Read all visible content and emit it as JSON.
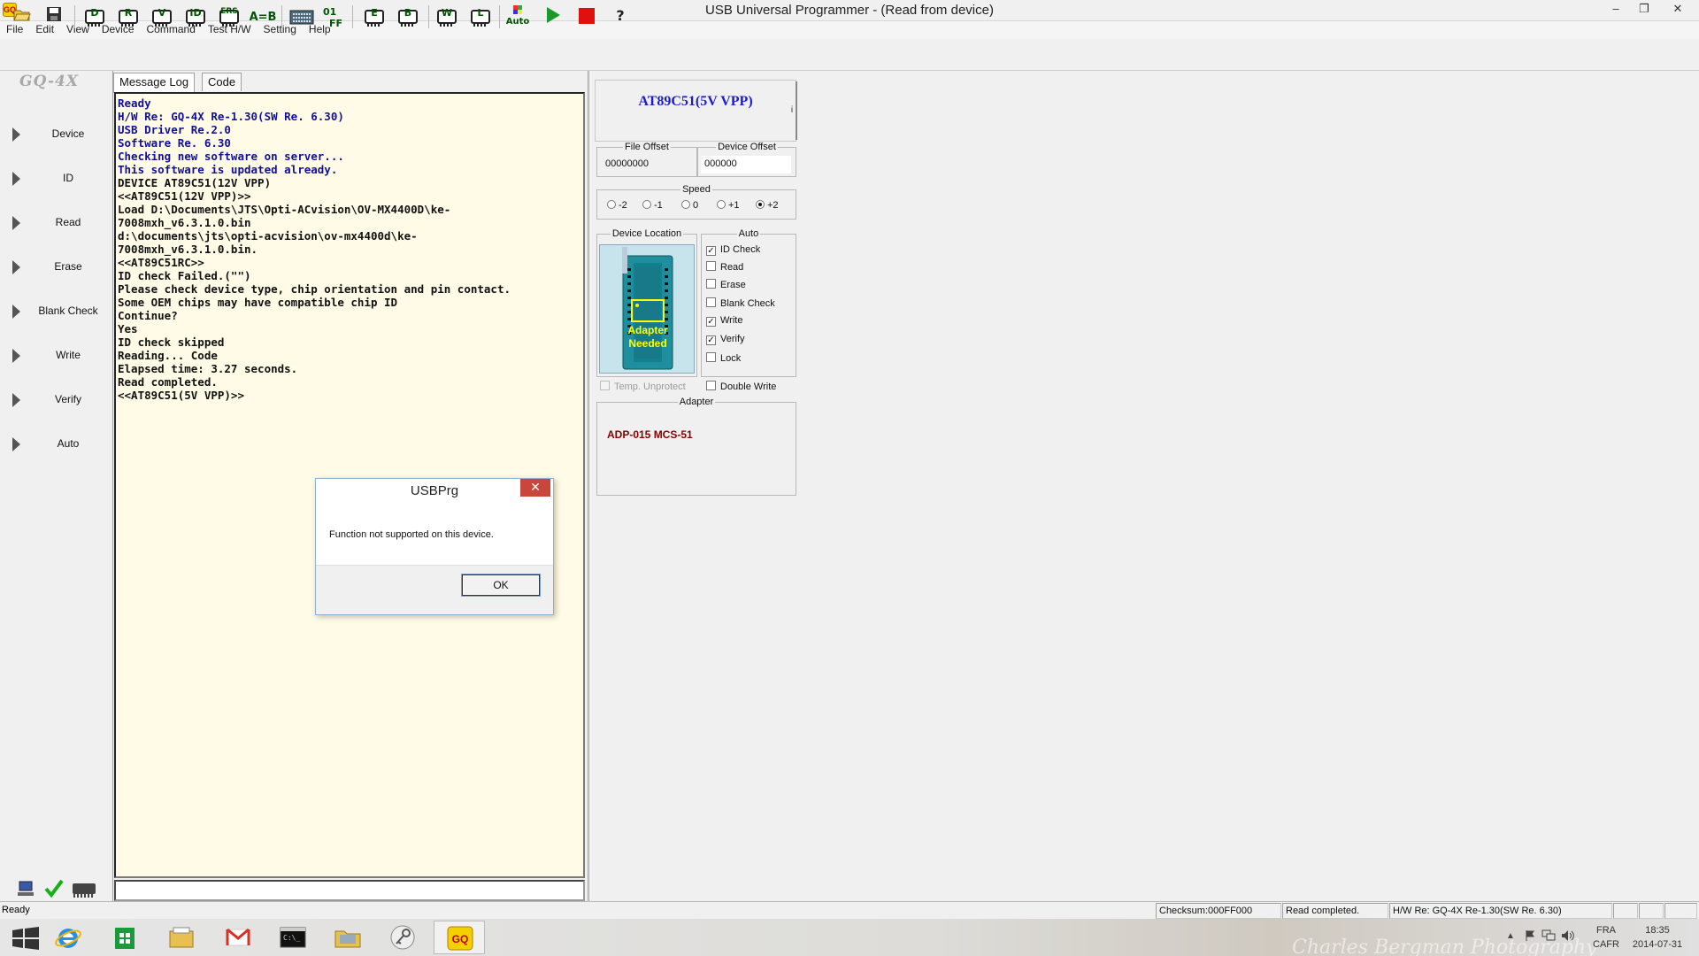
{
  "window": {
    "title": "USB Universal Programmer - (Read from device)",
    "app_icon_text": "GQ",
    "minimize_glyph": "–",
    "restore_glyph": "❐",
    "close_glyph": "✕"
  },
  "menu": [
    "File",
    "Edit",
    "View",
    "Device",
    "Command",
    "Test H/W",
    "Setting",
    "Help"
  ],
  "toolbar": {
    "buttons": [
      {
        "name": "open-icon",
        "label": ""
      },
      {
        "name": "save-icon",
        "label": ""
      },
      {
        "name": "device-icon",
        "label": "D"
      },
      {
        "name": "read-icon",
        "label": "R"
      },
      {
        "name": "verify-icon",
        "label": "V"
      },
      {
        "name": "id-icon",
        "label": "ID"
      },
      {
        "name": "erase-icon",
        "label": "ERS"
      },
      {
        "name": "compare-icon",
        "label": "A=B"
      },
      {
        "name": "keyboard-icon",
        "label": ""
      },
      {
        "name": "blank-check-icon",
        "label": "01FF"
      },
      {
        "name": "edit-icon",
        "label": "E"
      },
      {
        "name": "buffer-icon",
        "label": "B"
      },
      {
        "name": "write-icon",
        "label": "W"
      },
      {
        "name": "lock-icon",
        "label": "L"
      },
      {
        "name": "auto-icon",
        "label": "Auto"
      },
      {
        "name": "play-icon",
        "label": ""
      },
      {
        "name": "stop-icon",
        "label": ""
      },
      {
        "name": "help-icon",
        "label": "?"
      }
    ]
  },
  "left_nav": {
    "logo": "GQ-4X",
    "items": [
      "Device",
      "ID",
      "Read",
      "Erase",
      "Blank Check",
      "Write",
      "Verify",
      "Auto"
    ]
  },
  "tabs": [
    "Message Log",
    "Code"
  ],
  "log": [
    {
      "text": "Ready",
      "color": "blue"
    },
    {
      "text": "H/W Re: GQ-4X Re-1.30(SW Re. 6.30)",
      "color": "blue"
    },
    {
      "text": "USB Driver Re.2.0",
      "color": "blue"
    },
    {
      "text": "Software Re. 6.30",
      "color": "blue"
    },
    {
      "text": "Checking new software on server...",
      "color": "blue"
    },
    {
      "text": "This software is updated already.",
      "color": "blue"
    },
    {
      "text": "DEVICE AT89C51(12V VPP)",
      "color": "black"
    },
    {
      "text": "<<AT89C51(12V VPP)>>",
      "color": "black"
    },
    {
      "text": "Load D:\\Documents\\JTS\\Opti-ACvision\\OV-MX4400D\\ke-",
      "color": "black"
    },
    {
      "text": "7008mxh_v6.3.1.0.bin",
      "color": "black"
    },
    {
      "text": "d:\\documents\\jts\\opti-acvision\\ov-mx4400d\\ke-",
      "color": "black"
    },
    {
      "text": "7008mxh_v6.3.1.0.bin.",
      "color": "black"
    },
    {
      "text": "<<AT89C51RC>>",
      "color": "black"
    },
    {
      "text": "ID check Failed.(\"\")",
      "color": "black"
    },
    {
      "text": "Please check device type, chip orientation and pin contact.",
      "color": "black"
    },
    {
      "text": "Some OEM chips may have compatible chip ID",
      "color": "black"
    },
    {
      "text": "Continue?",
      "color": "black"
    },
    {
      "text": "Yes",
      "color": "black"
    },
    {
      "text": "ID check skipped",
      "color": "black"
    },
    {
      "text": "Reading... Code",
      "color": "black"
    },
    {
      "text": "Elapsed time: 3.27 seconds.",
      "color": "black"
    },
    {
      "text": "Read completed.",
      "color": "black"
    },
    {
      "text": "<<AT89C51(5V VPP)>>",
      "color": "black"
    }
  ],
  "device_panel": {
    "device_name": "AT89C51(5V VPP)",
    "info_label": "i",
    "file_offset_label": "File Offset",
    "file_offset_value": "00000000",
    "device_offset_label": "Device Offset",
    "device_offset_value": "000000",
    "speed_label": "Speed",
    "speed_options": [
      "-2",
      "-1",
      "0",
      "+1",
      "+2"
    ],
    "speed_selected": "+2",
    "device_location_label": "Device Location",
    "adapter_needed_line1": "Adapter",
    "adapter_needed_line2": "Needed",
    "auto_label": "Auto",
    "auto_options": [
      {
        "label": "ID Check",
        "checked": true
      },
      {
        "label": "Read",
        "checked": false
      },
      {
        "label": "Erase",
        "checked": false
      },
      {
        "label": "Blank Check",
        "checked": false
      },
      {
        "label": "Write",
        "checked": true
      },
      {
        "label": "Verify",
        "checked": true
      },
      {
        "label": "Lock",
        "checked": false
      }
    ],
    "temp_unprotect_label": "Temp. Unprotect",
    "double_write_label": "Double Write",
    "adapter_label": "Adapter",
    "adapter_name": "ADP-015 MCS-51"
  },
  "dialog": {
    "title": "USBPrg",
    "close_glyph": "✕",
    "message": "Function not supported on this device.",
    "ok_label": "OK"
  },
  "statusbar": {
    "left": "Ready",
    "checksum": "Checksum:000FF000",
    "read_status": "Read completed.",
    "hw_version": "H/W Re: GQ-4X Re-1.30(SW Re. 6.30)"
  },
  "taskbar": {
    "apps": [
      "start-icon",
      "internet-explorer-icon",
      "store-icon",
      "file-explorer-icon",
      "gmail-icon",
      "command-prompt-icon",
      "folder-icon",
      "key-icon",
      "gq-programmer-icon"
    ],
    "language_line1": "FRA",
    "language_line2": "CAFR",
    "time": "18:35",
    "date": "2014-07-31",
    "watermark": "Charles Bergman Photography"
  },
  "colors": {
    "log_background": "#fffbe6",
    "log_blue": "#10109a",
    "device_name": "#1c1ccc",
    "adapter_name": "#8b0000",
    "dialog_close": "#c9463d"
  }
}
